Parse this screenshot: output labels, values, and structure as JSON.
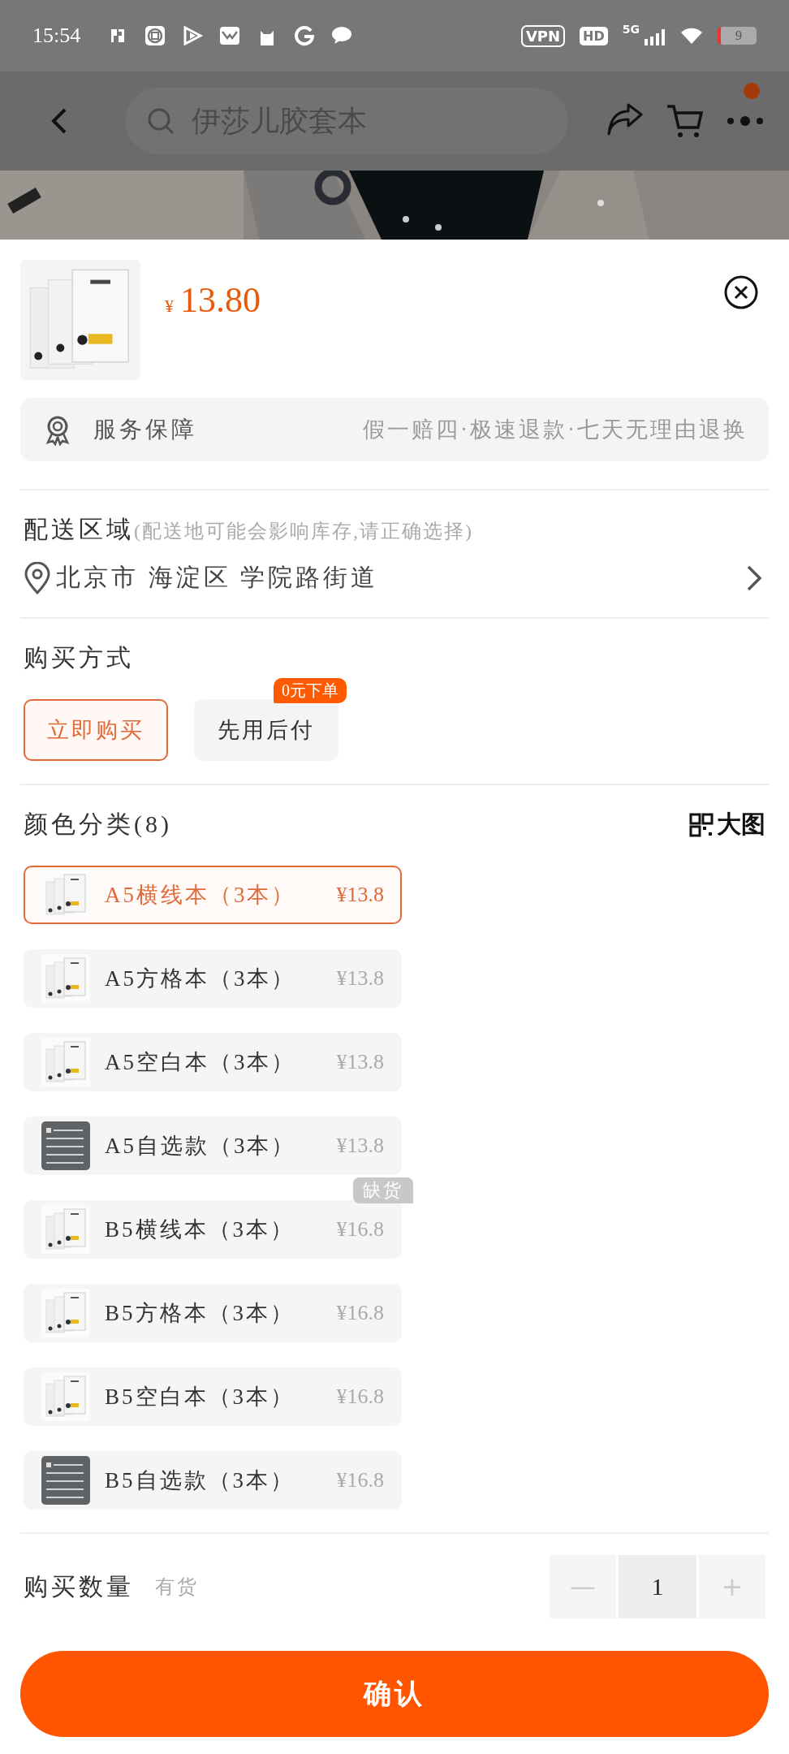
{
  "status_bar": {
    "time": "15:54",
    "vpn": "VPN",
    "hd": "HD",
    "network": "5G",
    "battery": "9"
  },
  "header": {
    "search_placeholder": "伊莎儿胶套本",
    "more_notification": true
  },
  "product": {
    "currency": "¥",
    "price": "13.80"
  },
  "service": {
    "label": "服务保障",
    "detail": "假一赔四·极速退款·七天无理由退换"
  },
  "delivery": {
    "title": "配送区域",
    "hint": "(配送地可能会影响库存,请正确选择)",
    "address": "北京市 海淀区 学院路街道"
  },
  "purchase_method": {
    "title": "购买方式",
    "options": [
      {
        "label": "立即购买",
        "selected": true
      },
      {
        "label": "先用后付",
        "selected": false,
        "badge": "0元下单"
      }
    ]
  },
  "variants": {
    "title": "颜色分类(8)",
    "view_large": "大图",
    "items": [
      {
        "name": "A5横线本（3本）",
        "price": "¥13.8",
        "selected": true,
        "kind": "notebook"
      },
      {
        "name": "A5方格本（3本）",
        "price": "¥13.8",
        "selected": false,
        "kind": "notebook"
      },
      {
        "name": "A5空白本（3本）",
        "price": "¥13.8",
        "selected": false,
        "kind": "notebook"
      },
      {
        "name": "A5自选款（3本）",
        "price": "¥13.8",
        "selected": false,
        "kind": "card"
      },
      {
        "name": "B5横线本（3本）",
        "price": "¥16.8",
        "selected": false,
        "kind": "notebook",
        "badge": "缺货"
      },
      {
        "name": "B5方格本（3本）",
        "price": "¥16.8",
        "selected": false,
        "kind": "notebook"
      },
      {
        "name": "B5空白本（3本）",
        "price": "¥16.8",
        "selected": false,
        "kind": "notebook"
      },
      {
        "name": "B5自选款（3本）",
        "price": "¥16.8",
        "selected": false,
        "kind": "card"
      }
    ]
  },
  "quantity": {
    "title": "购买数量",
    "stock": "有货",
    "minus": "—",
    "value": "1",
    "plus": "+"
  },
  "confirm": {
    "label": "确认"
  }
}
